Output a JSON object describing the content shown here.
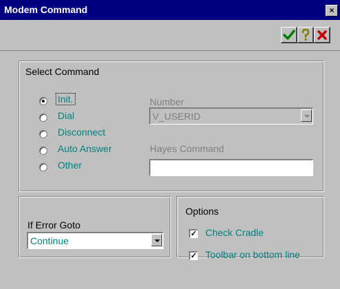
{
  "window": {
    "title": "Modem Command",
    "close_glyph": "×"
  },
  "toolbar": {
    "ok_icon": "checkmark-icon",
    "help_icon": "question-mark-icon",
    "cancel_icon": "x-cancel-icon",
    "ok_color": "#008000",
    "help_color": "#808000",
    "cancel_color": "#c00000"
  },
  "select_command": {
    "group_label": "Select Command",
    "options": [
      {
        "label": "Init.",
        "selected": true
      },
      {
        "label": "Dial",
        "selected": false
      },
      {
        "label": "Disconnect",
        "selected": false
      },
      {
        "label": "Auto Answer",
        "selected": false
      },
      {
        "label": "Other",
        "selected": false
      }
    ],
    "number_label": "Number",
    "number_value": "V_USERID",
    "hayes_label": "Hayes Command",
    "hayes_value": ""
  },
  "error_goto": {
    "label": "If Error Goto",
    "value": "Continue"
  },
  "options": {
    "group_label": "Options",
    "check_cradle": {
      "label": "Check Cradle",
      "checked": true
    },
    "toolbar_bottom": {
      "label": "Toolbar on bottom line",
      "checked": true
    }
  }
}
